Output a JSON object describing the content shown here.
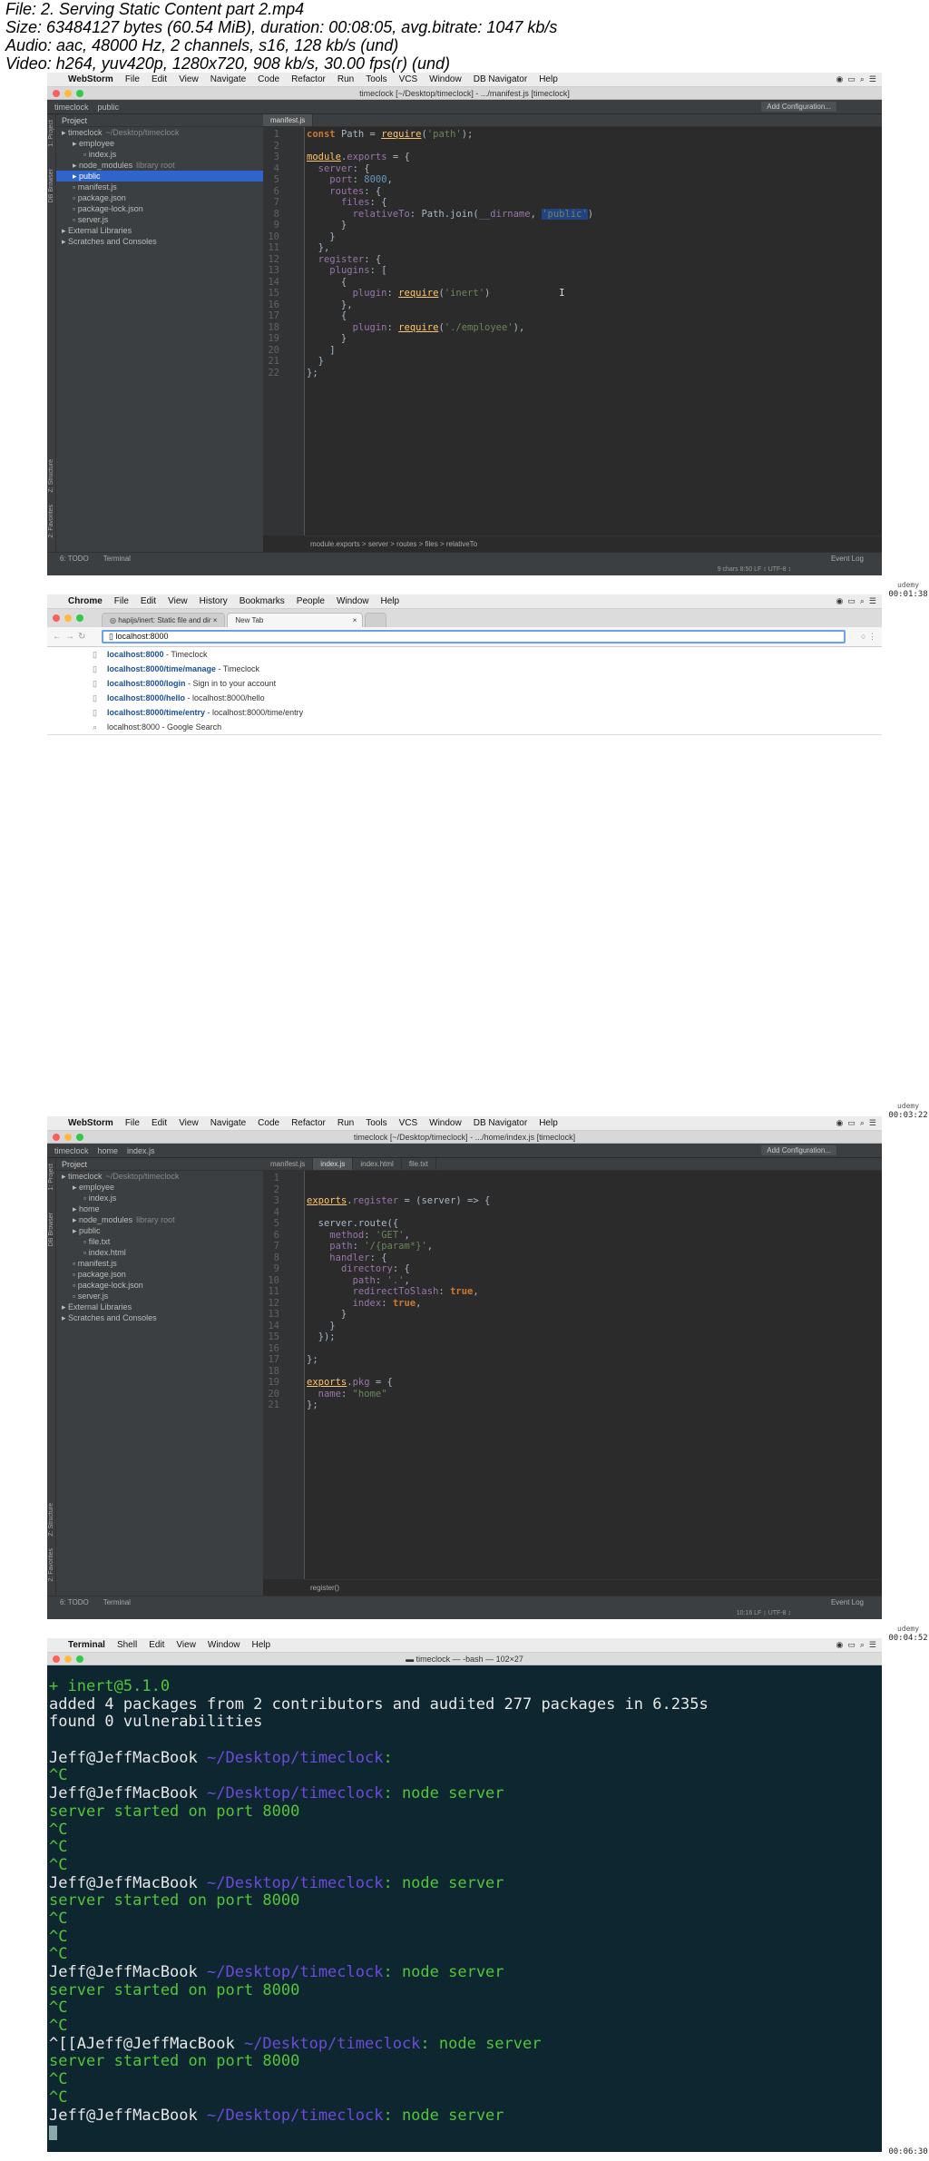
{
  "header": {
    "line1": "File: 2. Serving Static Content part 2.mp4",
    "line2": "Size: 63484127 bytes (60.54 MiB), duration: 00:08:05, avg.bitrate: 1047 kb/s",
    "line3": "Audio: aac, 48000 Hz, 2 channels, s16, 128 kb/s (und)",
    "line4": "Video: h264, yuv420p, 1280x720, 908 kb/s, 30.00 fps(r) (und)"
  },
  "timestamps": [
    "00:01:38",
    "00:03:22",
    "00:04:52",
    "00:06:30"
  ],
  "watermark": "udemy",
  "frame1": {
    "menu": [
      "WebStorm",
      "File",
      "Edit",
      "View",
      "Navigate",
      "Code",
      "Refactor",
      "Run",
      "Tools",
      "VCS",
      "Window",
      "DB Navigator",
      "Help"
    ],
    "title": "timeclock [~/Desktop/timeclock] - .../manifest.js [timeclock]",
    "nav": [
      "timeclock",
      "public"
    ],
    "add_config": "Add Configuration...",
    "panel_header": "Project",
    "tree": [
      {
        "label": "timeclock",
        "extra": "~/Desktop/timeclock",
        "indent": 0
      },
      {
        "label": "employee",
        "extra": "",
        "indent": 1
      },
      {
        "label": "index.js",
        "extra": "",
        "indent": 2
      },
      {
        "label": "node_modules",
        "extra": "library root",
        "indent": 1
      },
      {
        "label": "public",
        "extra": "",
        "indent": 1,
        "selected": true
      },
      {
        "label": "manifest.js",
        "extra": "",
        "indent": 1
      },
      {
        "label": "package.json",
        "extra": "",
        "indent": 1
      },
      {
        "label": "package-lock.json",
        "extra": "",
        "indent": 1
      },
      {
        "label": "server.js",
        "extra": "",
        "indent": 1
      },
      {
        "label": "External Libraries",
        "extra": "",
        "indent": 0
      },
      {
        "label": "Scratches and Consoles",
        "extra": "",
        "indent": 0
      }
    ],
    "tabs": [
      "manifest.js"
    ],
    "breadcrumb": "module.exports  >  server  >  routes  >  files  >  relativeTo",
    "status_left": [
      "6: TODO",
      "Terminal"
    ],
    "status_right": "Event Log",
    "status_pos": "9 chars   8:50   LF ↕   UTF-8 ↕"
  },
  "frame2": {
    "menu": [
      "Chrome",
      "File",
      "Edit",
      "View",
      "History",
      "Bookmarks",
      "People",
      "Window",
      "Help"
    ],
    "tabs": [
      "hapijs/inert: Static file and dir",
      "New Tab"
    ],
    "url": "localhost:8000",
    "suggestions": [
      {
        "url": "localhost:8000",
        "rest": " - Timeclock"
      },
      {
        "url": "localhost:8000/time/manage",
        "rest": " - Timeclock"
      },
      {
        "url": "localhost:8000/login",
        "rest": " - Sign in to your account"
      },
      {
        "url": "localhost:8000/hello",
        "rest": " - localhost:8000/hello"
      },
      {
        "url": "localhost:8000/time/entry",
        "rest": " - localhost:8000/time/entry"
      },
      {
        "url": "localhost:8000",
        "rest": " - Google Search"
      }
    ]
  },
  "frame3": {
    "title": "timeclock [~/Desktop/timeclock] - .../home/index.js [timeclock]",
    "nav": [
      "timeclock",
      "home",
      "index.js"
    ],
    "tree": [
      {
        "label": "timeclock",
        "extra": "~/Desktop/timeclock",
        "indent": 0
      },
      {
        "label": "employee",
        "extra": "",
        "indent": 1
      },
      {
        "label": "index.js",
        "extra": "",
        "indent": 2
      },
      {
        "label": "home",
        "extra": "",
        "indent": 1
      },
      {
        "label": "node_modules",
        "extra": "library root",
        "indent": 1
      },
      {
        "label": "public",
        "extra": "",
        "indent": 1
      },
      {
        "label": "file.txt",
        "extra": "",
        "indent": 2
      },
      {
        "label": "index.html",
        "extra": "",
        "indent": 2
      },
      {
        "label": "manifest.js",
        "extra": "",
        "indent": 1
      },
      {
        "label": "package.json",
        "extra": "",
        "indent": 1
      },
      {
        "label": "package-lock.json",
        "extra": "",
        "indent": 1
      },
      {
        "label": "server.js",
        "extra": "",
        "indent": 1
      },
      {
        "label": "External Libraries",
        "extra": "",
        "indent": 0
      },
      {
        "label": "Scratches and Consoles",
        "extra": "",
        "indent": 0
      }
    ],
    "tabs": [
      "manifest.js",
      "index.js",
      "index.html",
      "file.txt"
    ],
    "breadcrumb": "register()",
    "status_pos": "10:16   LF ↕   UTF-8 ↕"
  },
  "frame4": {
    "menu": [
      "Terminal",
      "Shell",
      "Edit",
      "View",
      "Window",
      "Help"
    ],
    "title": "timeclock — -bash — 102×27",
    "lines": [
      "+ inert@5.1.0",
      "added 4 packages from 2 contributors and audited 277 packages in 6.235s",
      "found 0 vulnerabilities",
      "",
      "Jeff@JeffMacBook ~/Desktop/timeclock:",
      "^C",
      "Jeff@JeffMacBook ~/Desktop/timeclock: node server",
      "server started on port 8000",
      "^C",
      "^C",
      "^C",
      "Jeff@JeffMacBook ~/Desktop/timeclock: node server",
      "server started on port 8000",
      "^C",
      "^C",
      "^C",
      "Jeff@JeffMacBook ~/Desktop/timeclock: node server",
      "server started on port 8000",
      "^C",
      "^C",
      "^[[AJeff@JeffMacBook ~/Desktop/timeclock: node server",
      "server started on port 8000",
      "^C",
      "^C",
      "Jeff@JeffMacBook ~/Desktop/timeclock: node server"
    ]
  }
}
